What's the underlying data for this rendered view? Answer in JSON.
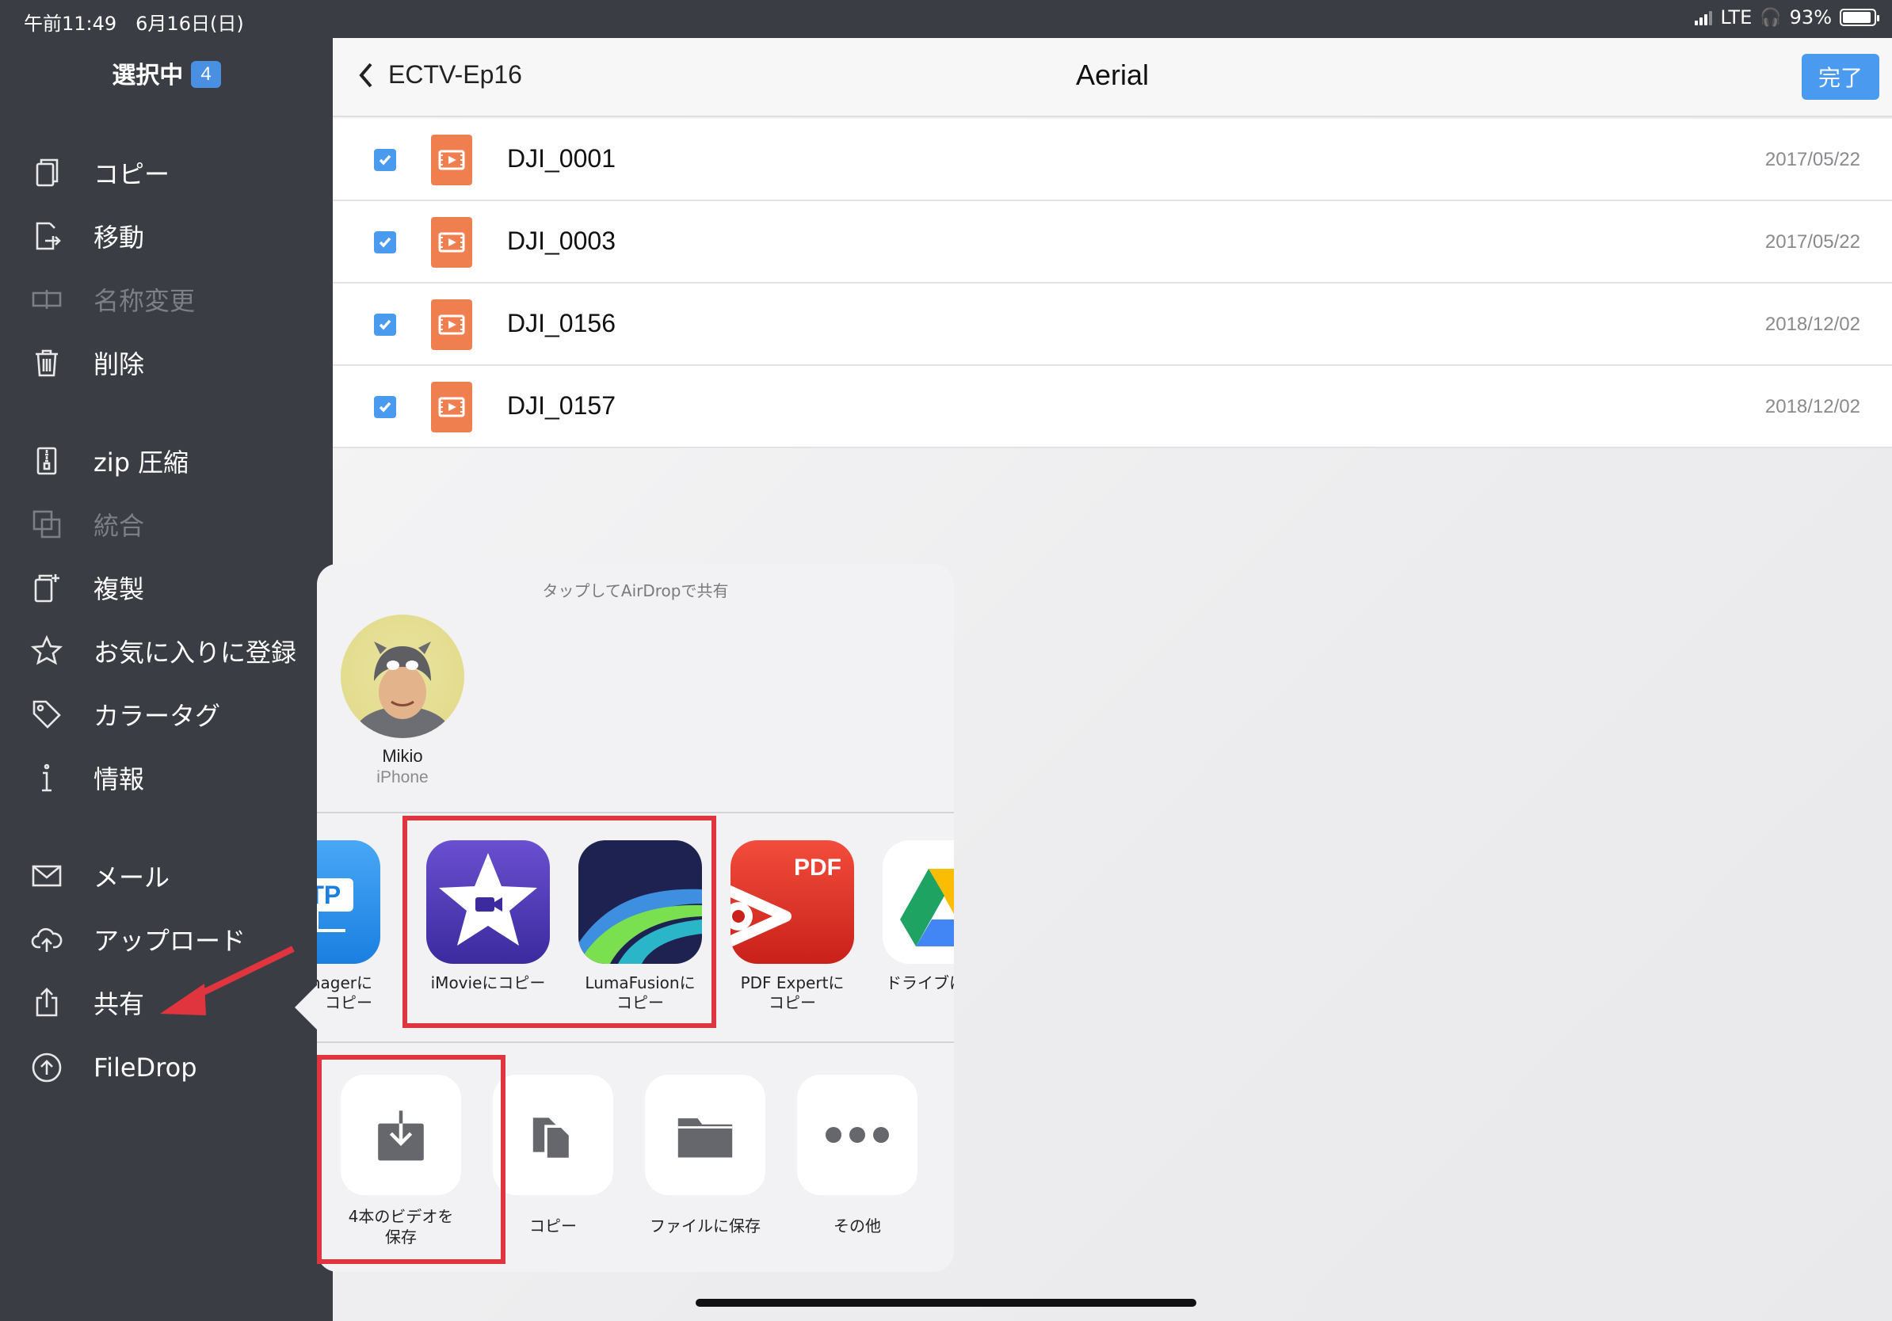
{
  "status": {
    "time_date": "午前11:49　6月16日(日)",
    "network": "LTE",
    "battery_percent": "93%",
    "battery_level": 0.93
  },
  "sidebar": {
    "title": "選択中",
    "selected_count": "4",
    "items": [
      {
        "label": "コピー",
        "icon": "copy-icon",
        "enabled": true
      },
      {
        "label": "移動",
        "icon": "move-icon",
        "enabled": true
      },
      {
        "label": "名称変更",
        "icon": "rename-icon",
        "enabled": false
      },
      {
        "label": "削除",
        "icon": "trash-icon",
        "enabled": true
      },
      {
        "label": "zip 圧縮",
        "icon": "zip-icon",
        "enabled": true
      },
      {
        "label": "統合",
        "icon": "merge-icon",
        "enabled": false
      },
      {
        "label": "複製",
        "icon": "duplicate-icon",
        "enabled": true
      },
      {
        "label": "お気に入りに登録",
        "icon": "star-icon",
        "enabled": true
      },
      {
        "label": "カラータグ",
        "icon": "tag-icon",
        "enabled": true
      },
      {
        "label": "情報",
        "icon": "info-icon",
        "enabled": true
      },
      {
        "label": "メール",
        "icon": "mail-icon",
        "enabled": true
      },
      {
        "label": "アップロード",
        "icon": "cloud-upload-icon",
        "enabled": true
      },
      {
        "label": "共有",
        "icon": "share-icon",
        "enabled": true
      },
      {
        "label": "FileDrop",
        "icon": "filedrop-icon",
        "enabled": true
      }
    ]
  },
  "navbar": {
    "back_label": "ECTV-Ep16",
    "title": "Aerial",
    "done_label": "完了"
  },
  "files": [
    {
      "name": "DJI_0001",
      "date": "2017/05/22",
      "checked": true
    },
    {
      "name": "DJI_0003",
      "date": "2017/05/22",
      "checked": true
    },
    {
      "name": "DJI_0156",
      "date": "2018/12/02",
      "checked": true
    },
    {
      "name": "DJI_0157",
      "date": "2018/12/02",
      "checked": true
    }
  ],
  "share_sheet": {
    "airdrop_hint": "タップしてAirDropで共有",
    "airdrop_person": {
      "name": "Mikio",
      "device": "iPhone"
    },
    "apps": [
      {
        "label": "Managerに\nコピー",
        "icon": "ftp-manager-icon"
      },
      {
        "label": "iMovieにコピー",
        "icon": "imovie-icon"
      },
      {
        "label": "LumaFusionに\nコピー",
        "icon": "lumafusion-icon"
      },
      {
        "label": "PDF Expertに\nコピー",
        "icon": "pdf-expert-icon"
      },
      {
        "label": "ドライブに",
        "icon": "google-drive-icon"
      }
    ],
    "actions": [
      {
        "label": "4本のビデオを\n保存",
        "icon": "save-video-icon"
      },
      {
        "label": "コピー",
        "icon": "copy-docs-icon"
      },
      {
        "label": "ファイルに保存",
        "icon": "folder-icon"
      },
      {
        "label": "その他",
        "icon": "more-icon"
      }
    ],
    "ftp_badge": "FTP",
    "pdf_badge": "PDF"
  },
  "colors": {
    "sidebar_bg": "#3a3d43",
    "accent": "#4a9bef",
    "video_icon": "#f07f50",
    "highlight_red": "#e0353f"
  }
}
